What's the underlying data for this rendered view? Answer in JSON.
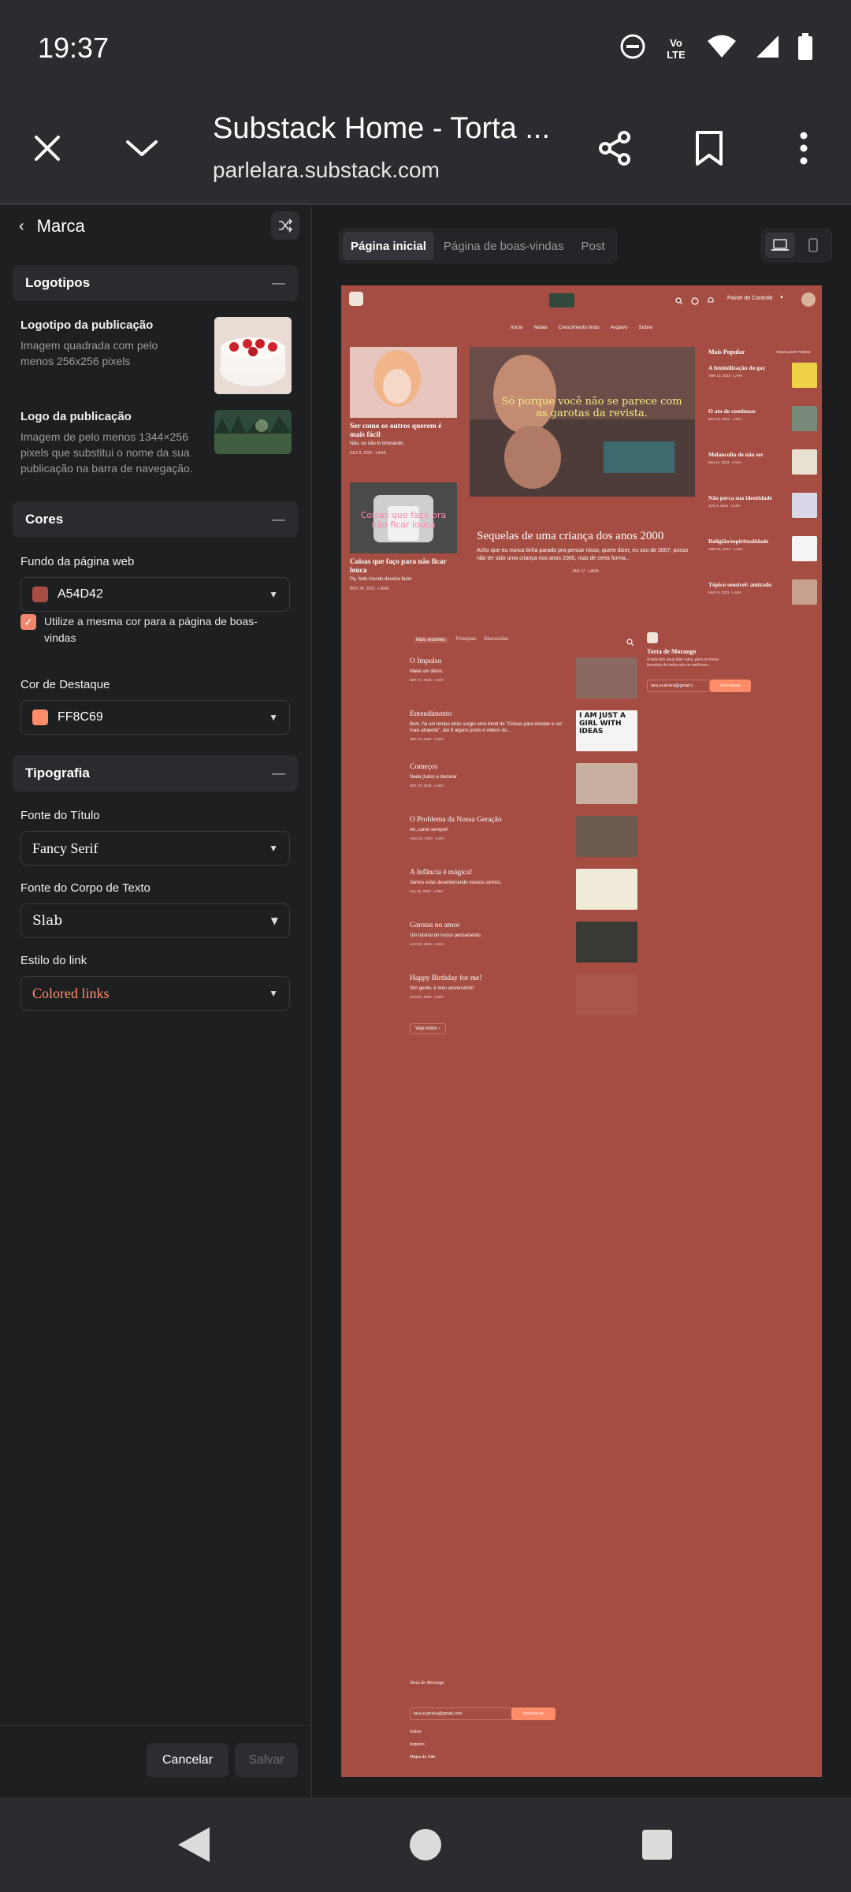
{
  "status": {
    "time": "19:37",
    "network": "Vo LTE"
  },
  "browser": {
    "title": "Substack Home - Torta ...",
    "url": "parlelara.substack.com"
  },
  "sidebar": {
    "header": "Marca",
    "sections": {
      "logos": "Logotipos",
      "colors": "Cores",
      "typography": "Tipografia"
    },
    "logo_pub": {
      "label": "Logotipo da publicação",
      "desc": "Imagem quadrada com pelo menos 256x256 pixels"
    },
    "logo_wide": {
      "label": "Logo da publicação",
      "desc": "Imagem de pelo menos 1344×256 pixels que substitui o nome da sua publicação na barra de navegação."
    },
    "bg": {
      "label": "Fundo da página web",
      "value": "A54D42",
      "color": "#a54d42"
    },
    "same_color": "Utilize a mesma cor para a página de boas-vindas",
    "accent": {
      "label": "Cor de Destaque",
      "value": "FF8C69",
      "color": "#ff8c69"
    },
    "title_font": {
      "label": "Fonte do Título",
      "value": "Fancy Serif"
    },
    "body_font": {
      "label": "Fonte do Corpo de Texto",
      "value": "Slab"
    },
    "link_style": {
      "label": "Estilo do link",
      "value": "Colored links"
    },
    "cancel": "Cancelar",
    "save": "Salvar"
  },
  "tabs": [
    "Página inicial",
    "Página de boas-vindas",
    "Post"
  ],
  "preview": {
    "nav": [
      "Início",
      "Notas",
      "Crescimento lindo",
      "Arquivo",
      "Sobre"
    ],
    "dashboard": "Painel de Controle",
    "posts_left": [
      {
        "title": "Ser como os outros querem é mais fácil",
        "sub": "Não, eu não to brincando.",
        "date": "DEZ 8, 2023 · LARA"
      },
      {
        "title": "Coisas que faço para não ficar louca",
        "sub": "Pq. fodo mundo deveria fazer",
        "date": "NOV 24, 2023 · LARA"
      }
    ],
    "caption": "Só porque você não se parece com as garotas da revista.",
    "hero": {
      "title": "Sequelas de uma criança dos anos 2000",
      "sub": "Acho que eu nunca tinha parado pra pensar nisso, quero dizer, eu sou de 2007, posso não ter sido uma criança nos anos 2000, mas de certa forma...",
      "date": "JAN 17 · LARA"
    },
    "popular_title": "Mais Popular",
    "popular_all": "VISUALIZAR TODOS",
    "popular": [
      {
        "title": "A feminilização do gay",
        "date": "ABR 13, 2023 · LARA"
      },
      {
        "title": "O ato de continuar",
        "date": "MAI 13, 2023 · LARA"
      },
      {
        "title": "Melancolia de não ser",
        "date": "MAI 11, 2023 · LARA"
      },
      {
        "title": "Não perca sua identidade",
        "date": "JUN 3, 2023 · LARA"
      },
      {
        "title": "Religião/espiritualidade",
        "date": "ABR 20, 2023 · LARA"
      },
      {
        "title": "Tópico sensível: amizade.",
        "date": "MAR 9, 2023 · LARA"
      }
    ],
    "list_tabs": [
      "Mais recentes",
      "Principais",
      "Discussões"
    ],
    "posts": [
      {
        "title": "O Impulso",
        "sub": "Make um detox.",
        "date": "SET 27, 2023 · LARA"
      },
      {
        "title": "Entendimento",
        "sub": "Bom, há um tempo atrás surgiu uma trend de \"Coisas para estudar e ser mais atraente\", ate 9 alguns posts e vídeos do...",
        "date": "SET 21, 2023 · LARA"
      },
      {
        "title": "Começos",
        "sub": "Nada (tudo) a declarar",
        "date": "SET 19, 2023 · LARA"
      },
      {
        "title": "O Problema da Nossa Geração",
        "sub": "Ah, como sempre!",
        "date": "AGO 24, 2023 · LARA"
      },
      {
        "title": "A Infância é mágica!",
        "sub": "Vamos estar desenterrando nossos sonhos.",
        "date": "JUL 22, 2023 · LARA"
      },
      {
        "title": "Garotas no amor",
        "sub": "Um tutorial do nosso pensamento.",
        "date": "JUN 26, 2023 · LARA"
      },
      {
        "title": "Happy Birthday for me!",
        "sub": "Sim gente, é meu aniversário!!",
        "date": "JUN 21, 2023 · LARA"
      }
    ],
    "see_all": "Veja todos",
    "side_title": "Torta de Morango",
    "side_desc": "A vida tem seus dias ruins, pero os meus favoritos de todos são os melhores...",
    "email": "lara.scarrera@gmail.c",
    "subscribe": "Inscreva-se",
    "footer_title": "Torta de Morango",
    "footer_email": "lara.scarrera@gmail.com",
    "footer_sub": "Inscreva-se",
    "footer_links": [
      "Sobre",
      "Arquivo",
      "Mapa do Site"
    ],
    "img_text": [
      "Coisas que faço pra não ficar louca",
      "I AM JUST A GIRL WITH IDEAS"
    ]
  }
}
